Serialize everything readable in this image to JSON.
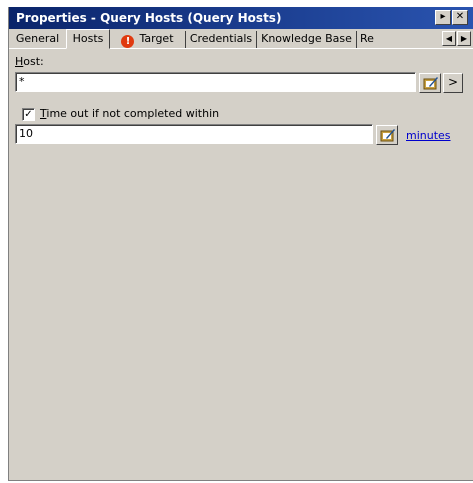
{
  "window": {
    "title": "Properties - Query Hosts (Query Hosts)"
  },
  "tabs": [
    {
      "label": "General"
    },
    {
      "label": "Hosts"
    },
    {
      "label": "Target"
    },
    {
      "label": "Credentials"
    },
    {
      "label": "Knowledge Base"
    },
    {
      "label": "Re"
    }
  ],
  "host": {
    "label_hotkey": "H",
    "label_rest": "ost:",
    "value": "*"
  },
  "timeout": {
    "checked": true,
    "label_hotkey": "T",
    "label_rest": "ime out if not completed within",
    "value": "10",
    "unit_link": "minutes"
  },
  "colors": {
    "titlebar": "#0a246a",
    "face": "#d4d0c8",
    "link": "#0000cc"
  },
  "icons": [
    "pin-icon",
    "close-icon",
    "warning-icon",
    "edit-icon",
    "arrow-right-icon",
    "arrow-left-icon"
  ]
}
